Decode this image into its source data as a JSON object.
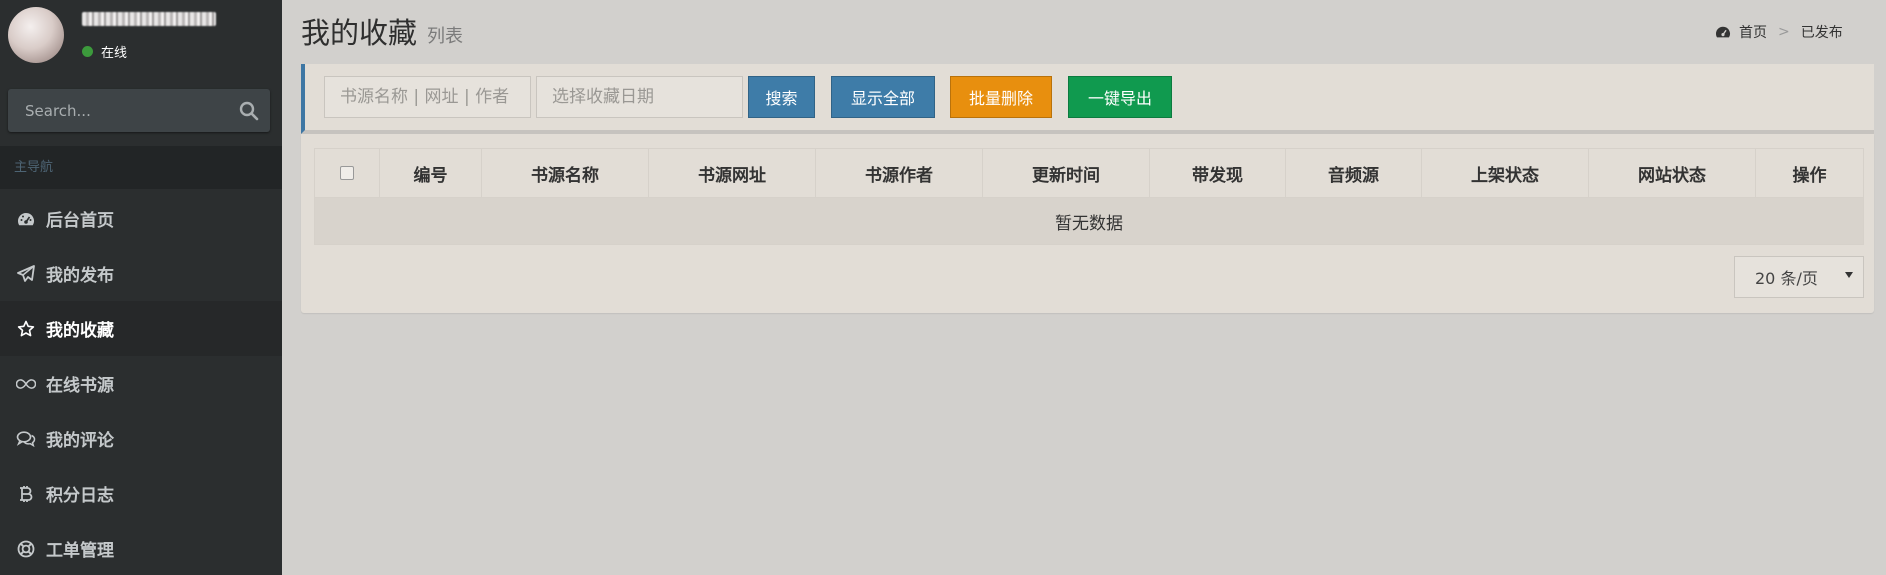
{
  "user": {
    "status": "在线"
  },
  "sidebar": {
    "search_placeholder": "Search...",
    "nav_header": "主导航",
    "items": [
      {
        "label": "后台首页",
        "icon": "dashboard-icon"
      },
      {
        "label": "我的发布",
        "icon": "paper-plane-icon"
      },
      {
        "label": "我的收藏",
        "icon": "star-icon",
        "active": true
      },
      {
        "label": "在线书源",
        "icon": "infinity-icon"
      },
      {
        "label": "我的评论",
        "icon": "comments-icon"
      },
      {
        "label": "积分日志",
        "icon": "bitcoin-icon"
      },
      {
        "label": "工单管理",
        "icon": "life-ring-icon"
      }
    ]
  },
  "header": {
    "title": "我的收藏",
    "subtitle": "列表",
    "breadcrumb": {
      "home": "首页",
      "current": "已发布"
    }
  },
  "toolbar": {
    "search_placeholder": "书源名称 | 网址 | 作者",
    "date_placeholder": "选择收藏日期",
    "search_label": "搜索",
    "show_all_label": "显示全部",
    "batch_delete_label": "批量删除",
    "export_label": "一键导出"
  },
  "table": {
    "columns": [
      "编号",
      "书源名称",
      "书源网址",
      "书源作者",
      "更新时间",
      "带发现",
      "音频源",
      "上架状态",
      "网站状态",
      "操作"
    ],
    "empty_text": "暂无数据"
  },
  "pagination": {
    "page_size": "20 条/页"
  },
  "colors": {
    "sidebar_bg": "#2b2e2f",
    "primary": "#3e7ca8",
    "warning": "#e88f0e",
    "success": "#109a4f",
    "status_online": "#3c9a3c"
  }
}
